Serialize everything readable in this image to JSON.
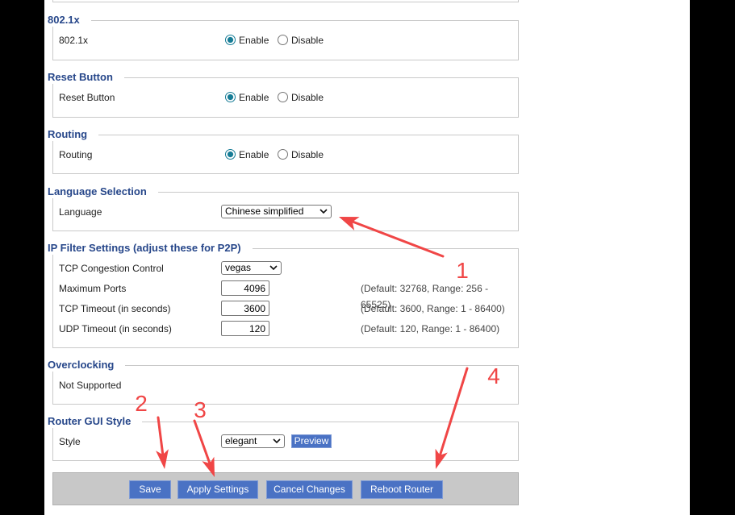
{
  "colors": {
    "page_background": "#000000",
    "panel_background": "#ffffff",
    "legend_text": "#27478a",
    "button": "#4a72c4",
    "radio_checked": "#167c96",
    "button_bar": "#c8c8c8",
    "annotation": "#f04646"
  },
  "icons": {
    "select_arrow": "chevron-down-icon"
  },
  "sections": {
    "dot1x": {
      "legend": "802.1x",
      "label": "802.1x",
      "enable_label": "Enable",
      "disable_label": "Disable",
      "enabled": true
    },
    "reset_button": {
      "legend": "Reset Button",
      "label": "Reset Button",
      "enable_label": "Enable",
      "disable_label": "Disable",
      "enabled": true
    },
    "routing": {
      "legend": "Routing",
      "label": "Routing",
      "enable_label": "Enable",
      "disable_label": "Disable",
      "enabled": true
    },
    "language": {
      "legend": "Language Selection",
      "label": "Language",
      "value": "Chinese simplified"
    },
    "ip_filter": {
      "legend": "IP Filter Settings (adjust these for P2P)",
      "tcp_congestion": {
        "label": "TCP Congestion Control",
        "value": "vegas"
      },
      "max_ports": {
        "label": "Maximum Ports",
        "value": "4096",
        "hint": "(Default: 32768, Range: 256 - 65525)"
      },
      "tcp_timeout": {
        "label": "TCP Timeout (in seconds)",
        "value": "3600",
        "hint": "(Default: 3600, Range: 1 - 86400)"
      },
      "udp_timeout": {
        "label": "UDP Timeout (in seconds)",
        "value": "120",
        "hint": "(Default: 120, Range: 1 - 86400)"
      }
    },
    "overclocking": {
      "legend": "Overclocking",
      "status": "Not Supported"
    },
    "gui_style": {
      "legend": "Router GUI Style",
      "label": "Style",
      "value": "elegant",
      "preview_label": "Preview"
    }
  },
  "footer": {
    "save_label": "Save",
    "apply_label": "Apply Settings",
    "cancel_label": "Cancel Changes",
    "reboot_label": "Reboot Router"
  },
  "annotations": {
    "labels": [
      "1",
      "2",
      "3",
      "4"
    ]
  }
}
